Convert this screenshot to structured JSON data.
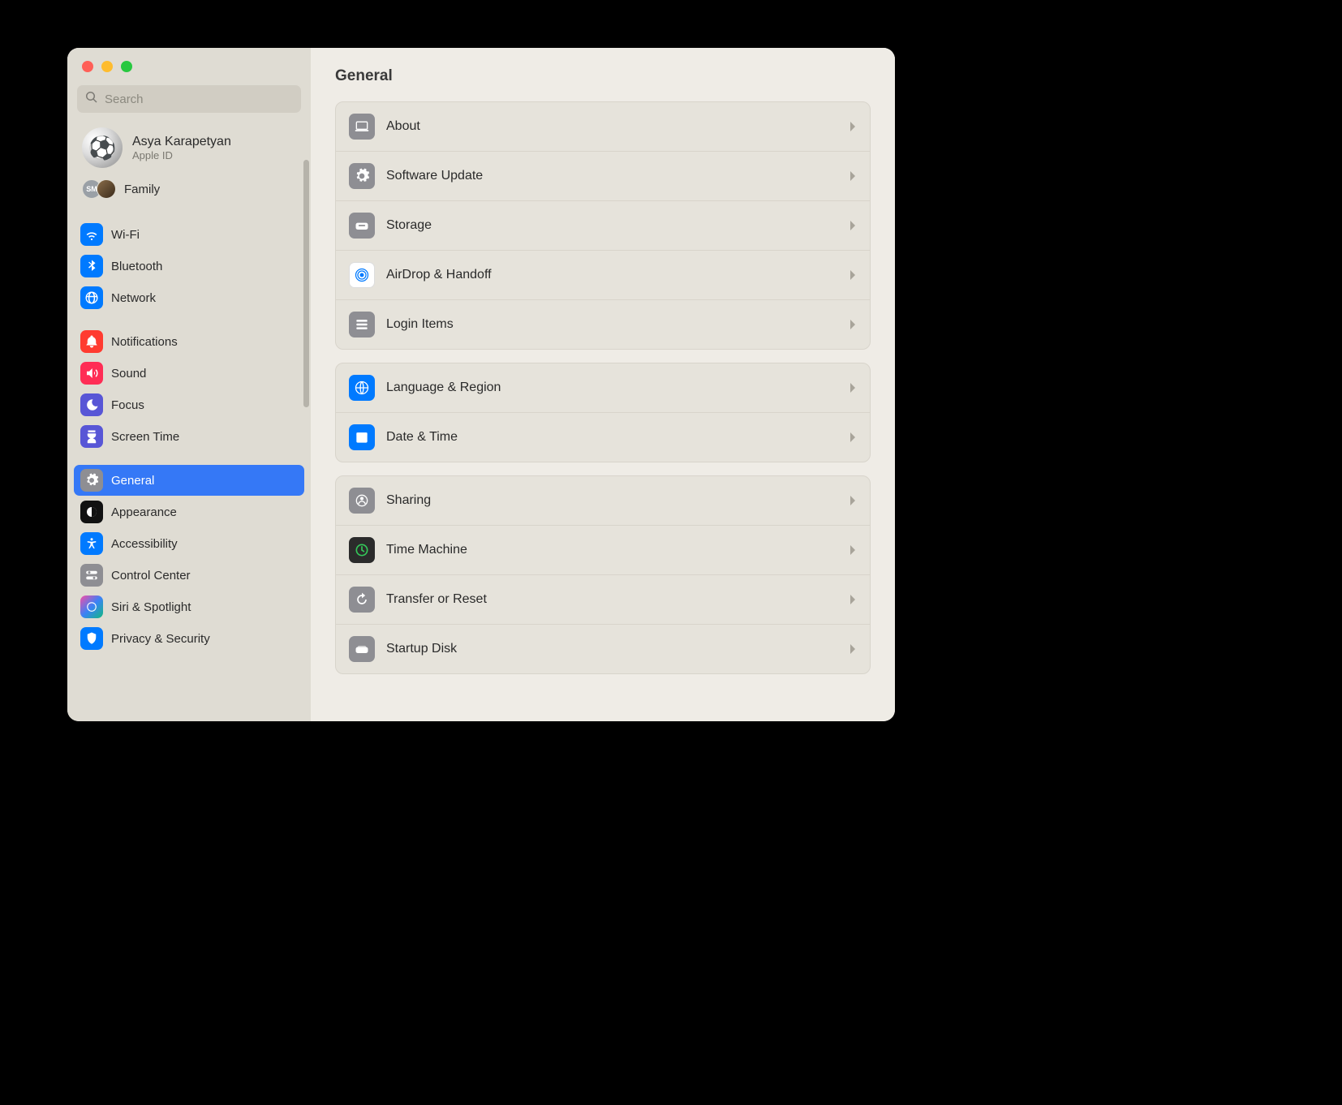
{
  "search": {
    "placeholder": "Search"
  },
  "account": {
    "name": "Asya Karapetyan",
    "sub": "Apple ID"
  },
  "family": {
    "label": "Family",
    "badge": "SM"
  },
  "sidebar": {
    "items": [
      {
        "label": "Wi-Fi",
        "color": "#007aff"
      },
      {
        "label": "Bluetooth",
        "color": "#007aff"
      },
      {
        "label": "Network",
        "color": "#007aff"
      },
      {
        "label": "Notifications",
        "color": "#ff3b30"
      },
      {
        "label": "Sound",
        "color": "#ff2d55"
      },
      {
        "label": "Focus",
        "color": "#5856d6"
      },
      {
        "label": "Screen Time",
        "color": "#5856d6"
      },
      {
        "label": "General",
        "color": "#8e8e93"
      },
      {
        "label": "Appearance",
        "color": "#111"
      },
      {
        "label": "Accessibility",
        "color": "#007aff"
      },
      {
        "label": "Control Center",
        "color": "#8e8e93"
      },
      {
        "label": "Siri & Spotlight",
        "color": "linear-gradient(135deg,#ff2d55,#5856d6,#34c759)"
      },
      {
        "label": "Privacy & Security",
        "color": "#007aff"
      }
    ]
  },
  "main": {
    "title": "General",
    "groups": [
      [
        {
          "label": "About",
          "icon": "laptop",
          "color": "#8e8e93"
        },
        {
          "label": "Software Update",
          "icon": "gear",
          "color": "#8e8e93"
        },
        {
          "label": "Storage",
          "icon": "disk",
          "color": "#8e8e93"
        },
        {
          "label": "AirDrop & Handoff",
          "icon": "airdrop",
          "color": "#ffffff",
          "accent": "#007aff"
        },
        {
          "label": "Login Items",
          "icon": "list",
          "color": "#8e8e93"
        }
      ],
      [
        {
          "label": "Language & Region",
          "icon": "globe",
          "color": "#007aff"
        },
        {
          "label": "Date & Time",
          "icon": "calendar",
          "color": "#007aff"
        }
      ],
      [
        {
          "label": "Sharing",
          "icon": "share",
          "color": "#8e8e93"
        },
        {
          "label": "Time Machine",
          "icon": "timemachine",
          "color": "#333",
          "accent": "#34c759"
        },
        {
          "label": "Transfer or Reset",
          "icon": "reset",
          "color": "#8e8e93"
        },
        {
          "label": "Startup Disk",
          "icon": "startup",
          "color": "#8e8e93"
        }
      ]
    ]
  }
}
